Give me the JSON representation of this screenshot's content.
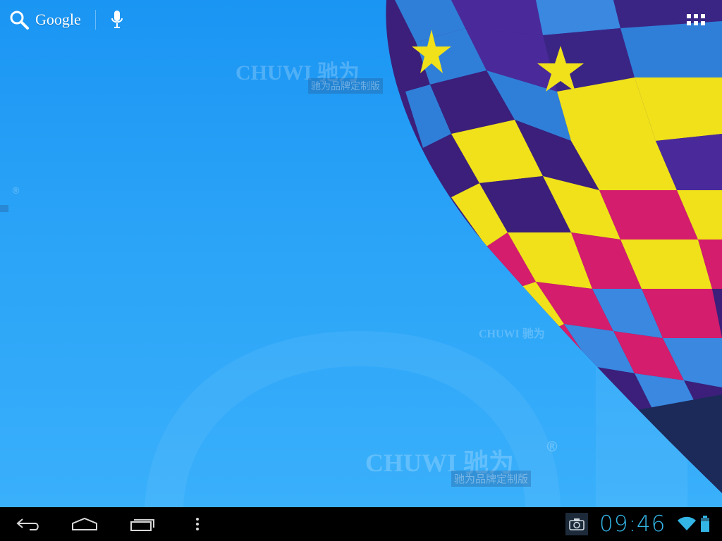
{
  "search": {
    "label": "Google"
  },
  "watermark": {
    "brand": "CHUWI 驰为",
    "brand_small": "CHUWI 驰为",
    "subtitle": "驰为品牌定制版",
    "registered": "®"
  },
  "status": {
    "time": "09:46"
  },
  "colors": {
    "clock": "#33b5e5",
    "sky": "#2aa3f7",
    "navbar": "#000000"
  },
  "icons": {
    "search": "search-icon",
    "mic": "microphone-icon",
    "apps": "app-grid-icon",
    "back": "back-icon",
    "home": "home-icon",
    "recents": "recent-apps-icon",
    "menu": "overflow-menu-icon",
    "screenshot": "camera-icon",
    "wifi": "wifi-icon",
    "battery": "battery-icon"
  }
}
